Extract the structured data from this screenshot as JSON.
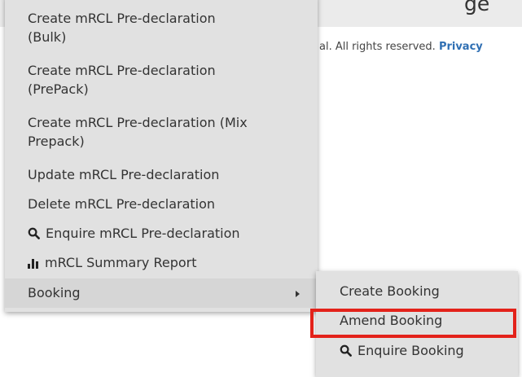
{
  "page": {
    "heading_fragment": "ge",
    "footer_text": "al. All rights reserved.",
    "privacy_link": "Privacy"
  },
  "menu": {
    "items": [
      {
        "lines": [
          "Create mRCL Pre-declaration",
          "(Bulk)"
        ]
      },
      {
        "lines": [
          "Create mRCL Pre-declaration",
          "(PrePack)"
        ]
      },
      {
        "lines": [
          "Create mRCL Pre-declaration (Mix",
          "Prepack)"
        ]
      },
      {
        "label": "Update mRCL Pre-declaration"
      },
      {
        "label": "Delete mRCL Pre-declaration"
      },
      {
        "label": "Enquire mRCL Pre-declaration",
        "icon": "search-icon"
      },
      {
        "label": "mRCL Summary Report",
        "icon": "bar-chart-icon"
      },
      {
        "label": "Booking",
        "icon": "chevron-right-icon"
      }
    ]
  },
  "submenu": {
    "items": [
      {
        "label": "Create Booking"
      },
      {
        "label": "Amend Booking"
      },
      {
        "label": "Enquire Booking",
        "icon": "search-icon"
      }
    ],
    "highlight_color": "#e3221a"
  }
}
